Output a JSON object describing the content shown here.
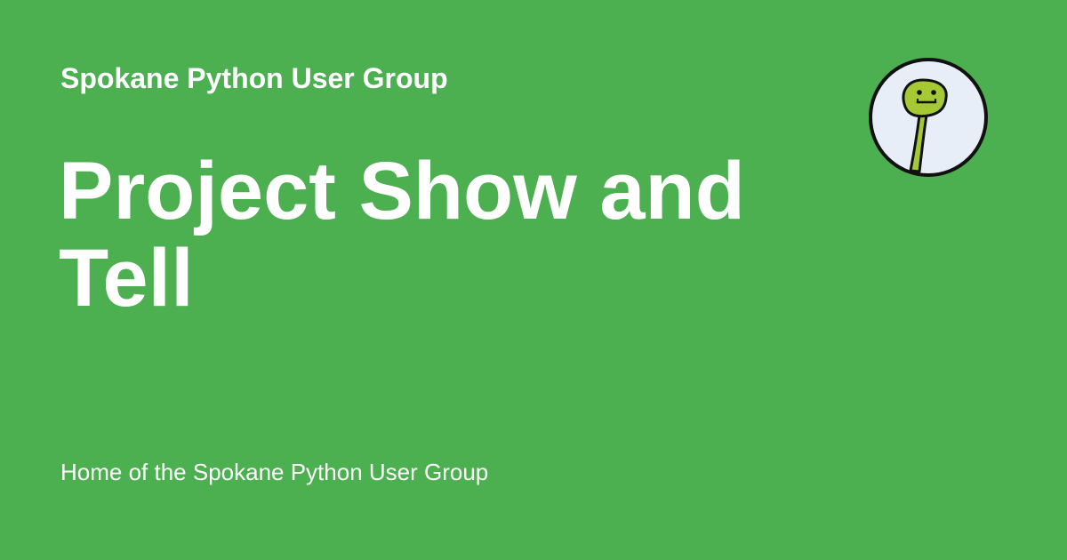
{
  "card": {
    "site_name": "Spokane Python User Group",
    "title": "Project Show and Tell",
    "tagline": "Home of the Spokane Python User Group",
    "logo": {
      "icon": "spug-mascot-logo-icon"
    }
  },
  "colors": {
    "background": "#4caf50",
    "text": "#ffffff",
    "logo_circle_fill": "#e8eef7",
    "logo_outline": "#111111",
    "mascot_body": "#a4c934"
  }
}
